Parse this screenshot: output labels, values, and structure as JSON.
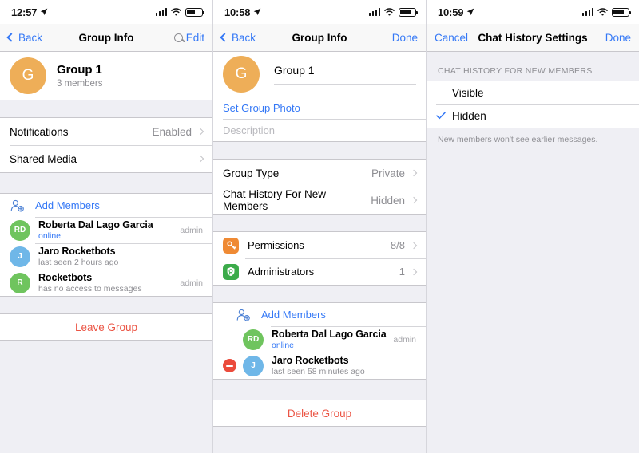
{
  "panel1": {
    "statusbar": {
      "time": "12:57",
      "location_icon": "location-arrow-icon",
      "signal_icon": "signal-bars-icon",
      "wifi_icon": "wifi-icon",
      "battery_icon": "battery-icon"
    },
    "nav": {
      "back_label": "Back",
      "title": "Group Info",
      "search_icon": "search-icon",
      "right_label": "Edit"
    },
    "group": {
      "avatar_letter": "G",
      "avatar_color": "#eeae58",
      "name": "Group 1",
      "members_count": "3 members"
    },
    "settings_rows": [
      {
        "label": "Notifications",
        "value": "Enabled"
      },
      {
        "label": "Shared Media",
        "value": ""
      }
    ],
    "add_members_label": "Add Members",
    "add_members_icon": "add-user-icon",
    "members": [
      {
        "initials": "RD",
        "color": "#6fc45e",
        "name": "Roberta Dal Lago Garcia",
        "status": "online",
        "online": true,
        "role": "admin"
      },
      {
        "initials": "J",
        "color": "#6fb7e8",
        "name": "Jaro Rocketbots",
        "status": "last seen 2 hours ago",
        "online": false,
        "role": ""
      },
      {
        "initials": "R",
        "color": "#6fc45e",
        "name": "Rocketbots",
        "status": "has no access to messages",
        "online": false,
        "role": "admin"
      }
    ],
    "leave_label": "Leave Group"
  },
  "panel2": {
    "statusbar": {
      "time": "10:58",
      "location_icon": "location-arrow-icon",
      "signal_icon": "signal-bars-icon",
      "wifi_icon": "wifi-icon",
      "battery_icon": "battery-icon"
    },
    "nav": {
      "back_label": "Back",
      "title": "Group Info",
      "right_label": "Done"
    },
    "group": {
      "avatar_letter": "G",
      "avatar_color": "#eeae58",
      "name": "Group 1"
    },
    "set_photo_label": "Set Group Photo",
    "description_placeholder": "Description",
    "settings_rows": [
      {
        "label": "Group Type",
        "value": "Private"
      },
      {
        "label": "Chat History For New Members",
        "value": "Hidden"
      }
    ],
    "tiles": [
      {
        "label": "Permissions",
        "value": "8/8",
        "icon": "key-icon",
        "color": "#ef8a34"
      },
      {
        "label": "Administrators",
        "value": "1",
        "icon": "shield-badge-icon",
        "color": "#3cab4a"
      }
    ],
    "add_members_label": "Add Members",
    "add_members_icon": "add-user-icon",
    "members": [
      {
        "initials": "RD",
        "color": "#6fc45e",
        "name": "Roberta Dal Lago Garcia",
        "status": "online",
        "online": true,
        "role": "admin",
        "removable": false
      },
      {
        "initials": "J",
        "color": "#6fb7e8",
        "name": "Jaro Rocketbots",
        "status": "last seen 58 minutes ago",
        "online": false,
        "role": "",
        "removable": true
      }
    ],
    "delete_label": "Delete Group"
  },
  "panel3": {
    "statusbar": {
      "time": "10:59",
      "location_icon": "location-arrow-icon",
      "signal_icon": "signal-bars-icon",
      "wifi_icon": "wifi-icon",
      "battery_icon": "battery-icon"
    },
    "nav": {
      "cancel_label": "Cancel",
      "title": "Chat History Settings",
      "right_label": "Done"
    },
    "section_header": "CHAT HISTORY FOR NEW MEMBERS",
    "options": [
      {
        "label": "Visible",
        "selected": false
      },
      {
        "label": "Hidden",
        "selected": true
      }
    ],
    "footer_note": "New members won't see earlier messages.",
    "check_icon": "checkmark-icon",
    "accent_color": "#3478f6"
  }
}
